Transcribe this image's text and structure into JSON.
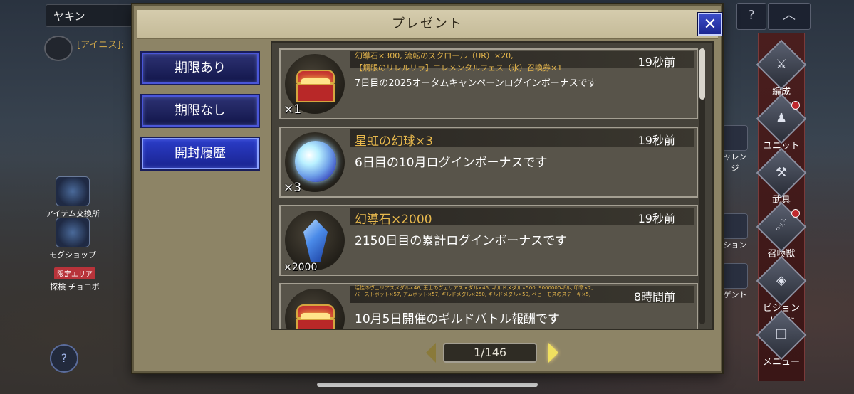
{
  "background": {
    "top_input": "ヤキン",
    "chat_text": "[アイニス]:",
    "left_items": [
      {
        "label": "アイテム交換所"
      },
      {
        "label": "モグショップ"
      },
      {
        "badge": "限定エリア",
        "label": "探検 チョコボ"
      }
    ],
    "help_glyph": "?",
    "collapse_glyph": "︿",
    "nav": [
      {
        "label": "編成"
      },
      {
        "label": "ユニット"
      },
      {
        "label": "武具"
      },
      {
        "label": "召喚獣"
      },
      {
        "label": "ビジョンカード"
      },
      {
        "label": "メニュー"
      }
    ],
    "mid_labels": [
      "ャレンジ",
      "ション",
      "ゲント"
    ]
  },
  "modal": {
    "title": "プレゼント",
    "close_glyph": "✕",
    "tabs": [
      {
        "label": "期限あり",
        "active": false
      },
      {
        "label": "期限なし",
        "active": false
      },
      {
        "label": "開封履歴",
        "active": true
      }
    ],
    "items": [
      {
        "icon": "treasure-chest",
        "qty": "×1",
        "title": "幻導石×300, 流転のスクロール（UR）×20,\n【炯眼のリレルリラ】エレメンタルフェス（氷）召喚券×1",
        "time": "19秒前",
        "desc": "7日目の2025オータムキャンペーンログインボーナスです"
      },
      {
        "icon": "rainbow-orb",
        "qty": "×3",
        "title": "星虹の幻球×3",
        "time": "19秒前",
        "desc": "6日目の10月ログインボーナスです"
      },
      {
        "icon": "blue-crystal",
        "qty": "×2000",
        "title": "幻導石×2000",
        "time": "19秒前",
        "desc": "2150日目の累計ログインボーナスです"
      },
      {
        "icon": "treasure-chest",
        "qty": "",
        "title": "活性のヴェリアスメダル×46, 王士のヴェリアスメダル×46, ギルドメダル×500, 9000000ギル, 印章×2,\nバーストポット×57, アムポット×57, ギルドメダル×250, ギルドメダル×50, ベヒーモスのステーキ×5,",
        "time": "8時間前",
        "desc": "10月5日開催のギルドバトル報酬です"
      }
    ],
    "pagination": "1/146"
  }
}
